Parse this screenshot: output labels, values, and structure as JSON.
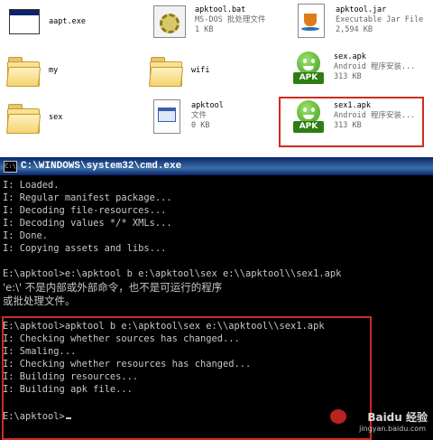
{
  "explorer": {
    "files": [
      {
        "name": "aapt.exe",
        "desc": "",
        "size": "",
        "icon": "exe-window-icon"
      },
      {
        "name": "apktool.bat",
        "desc": "MS-DOS 批处理文件",
        "size": "1 KB",
        "icon": "gear-bat-icon"
      },
      {
        "name": "apktool.jar",
        "desc": "Executable Jar File",
        "size": "2,594 KB",
        "icon": "java-jar-icon"
      },
      {
        "name": "my",
        "desc": "",
        "size": "",
        "icon": "folder-icon"
      },
      {
        "name": "wifi",
        "desc": "",
        "size": "",
        "icon": "folder-icon"
      },
      {
        "name": "sex.apk",
        "desc": "Android 程序安装...",
        "size": "313 KB",
        "icon": "android-apk-icon"
      },
      {
        "name": "sex",
        "desc": "",
        "size": "",
        "icon": "folder-icon"
      },
      {
        "name": "apktool",
        "desc": "文件",
        "size": "0 KB",
        "icon": "generic-file-icon"
      },
      {
        "name": "sex1.apk",
        "desc": "Android 程序安装...",
        "size": "313 KB",
        "icon": "android-apk-icon"
      }
    ],
    "apk_badge": "APK",
    "highlight_color": "#d12a1f"
  },
  "cmd": {
    "title": "C:\\WINDOWS\\system32\\cmd.exe",
    "title_icon": "C:\\",
    "lines": [
      "I: Loaded.",
      "I: Regular manifest package...",
      "I: Decoding file-resources...",
      "I: Decoding values */* XMLs...",
      "I: Done.",
      "I: Copying assets and libs...",
      "",
      "E:\\apktool>e:\\apktool b e:\\apktool\\sex e:\\\\apktool\\\\sex1.apk",
      "'e:\\' 不是内部或外部命令，也不是可运行的程序",
      "或批处理文件。",
      "",
      "E:\\apktool>apktool b e:\\apktool\\sex e:\\\\apktool\\\\sex1.apk",
      "I: Checking whether sources has changed...",
      "I: Smaling...",
      "I: Checking whether resources has changed...",
      "I: Building resources...",
      "I: Building apk file...",
      "",
      "E:\\apktool>"
    ],
    "text_color": "#c8c8c8",
    "background": "#000000"
  },
  "watermark": {
    "brand": "Baidu 经验",
    "url": "jingyan.baidu.com"
  }
}
